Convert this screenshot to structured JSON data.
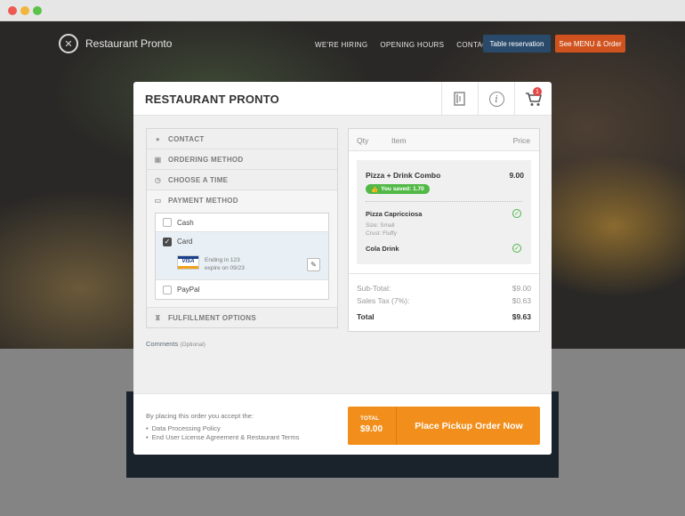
{
  "site": {
    "logo_text": "Restaurant Pronto",
    "nav": [
      "WE'RE HIRING",
      "OPENING HOURS",
      "CONTACT US"
    ],
    "table_reservation": "Table reservation",
    "menu_order": "See MENU & Order"
  },
  "modal": {
    "title": "RESTAURANT PRONTO",
    "header_icons": [
      "menu-book-icon",
      "info-icon",
      "cart-icon"
    ],
    "cart_count": "1",
    "sections": {
      "contact": "CONTACT",
      "ordering_method": "ORDERING METHOD",
      "choose_time": "CHOOSE A TIME",
      "payment_method": "PAYMENT METHOD",
      "fulfillment": "FULFILLMENT OPTIONS"
    },
    "payment": {
      "options": [
        "Cash",
        "Card",
        "PayPal"
      ],
      "selected": "Card",
      "card_brand": "VISA",
      "card_ending": "Ending in 123",
      "card_expiry": "expire on 09/23"
    },
    "comments_label": "Comments",
    "comments_optional": "(Optional)",
    "order": {
      "headers": {
        "qty": "Qty",
        "item": "Item",
        "price": "Price"
      },
      "combo_name": "Pizza + Drink Combo",
      "combo_price": "9.00",
      "saved": "You saved: 1.70",
      "sub_items": [
        {
          "name": "Pizza Capricciosa",
          "meta": [
            "Size: Small",
            "Crust: Fluffy"
          ]
        },
        {
          "name": "Cola Drink",
          "meta": []
        }
      ],
      "subtotal_label": "Sub-Total:",
      "subtotal": "$9.00",
      "tax_label": "Sales Tax (7%):",
      "tax": "$0.63",
      "total_label": "Total",
      "total": "$9.63"
    },
    "footer": {
      "policy_lead": "By placing this order you accept the:",
      "policies": [
        "Data Processing Policy",
        "End User License Agreement & Restaurant Terms"
      ],
      "total_label": "TOTAL",
      "total_amount": "$9.00",
      "cta": "Place Pickup Order Now"
    }
  }
}
